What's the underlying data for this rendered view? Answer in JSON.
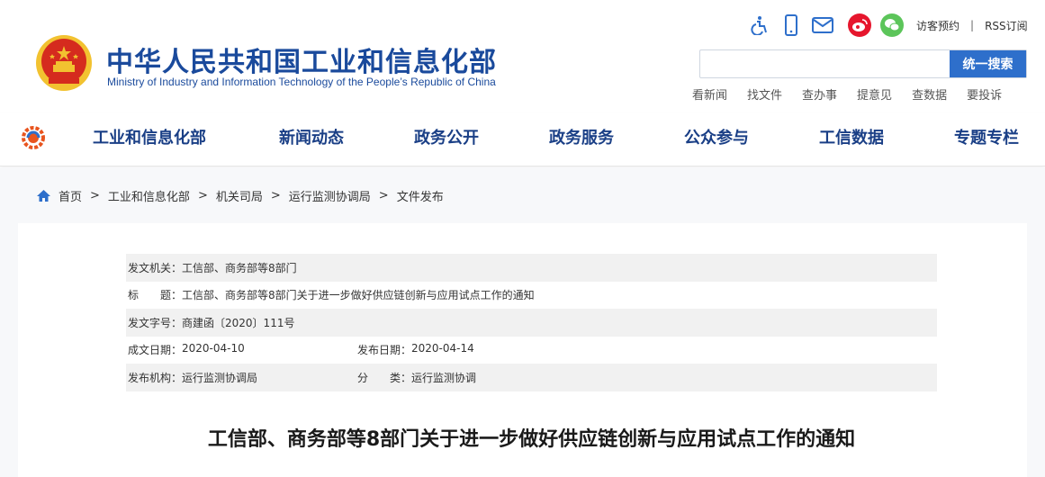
{
  "header": {
    "title_cn": "中华人民共和国工业和信息化部",
    "title_en": "Ministry of Industry and Information Technology of the People’s Republic of China",
    "utility_icons": [
      "accessibility-icon",
      "mobile-icon",
      "mail-icon",
      "weibo-icon",
      "wechat-icon"
    ],
    "visitor_label": "访客预约",
    "separator": "|",
    "rss_label": "RSS订阅",
    "search": {
      "placeholder": "",
      "button_label": "统一搜索"
    },
    "quick_links": [
      "看新闻",
      "找文件",
      "查办事",
      "提意见",
      "查数据",
      "要投诉"
    ]
  },
  "nav": {
    "items": [
      "工业和信息化部",
      "新闻动态",
      "政务公开",
      "政务服务",
      "公众参与",
      "工信数据",
      "专题专栏"
    ]
  },
  "breadcrumb": {
    "items": [
      "首页",
      "工业和信息化部",
      "机关司局",
      "运行监测协调局",
      "文件发布"
    ],
    "separator": ">"
  },
  "meta": {
    "issuer_label": "发文机关：",
    "issuer": "工信部、商务部等8部门",
    "title_label": "标　　题：",
    "title": "工信部、商务部等8部门关于进一步做好供应链创新与应用试点工作的通知",
    "doc_no_label": "发文字号：",
    "doc_no": "商建函〔2020〕111号",
    "created_label": "成文日期：",
    "created": "2020-04-10",
    "published_label": "发布日期：",
    "published": "2020-04-14",
    "agency_label": "发布机构：",
    "agency": "运行监测协调局",
    "category_label": "分　　类：",
    "category": "运行监测协调"
  },
  "article": {
    "title": "工信部、商务部等8部门关于进一步做好供应链创新与应用试点工作的通知"
  },
  "colors": {
    "brand_blue": "#1a4a9c",
    "nav_blue": "#1a3f86",
    "search_button": "#2e6fcb",
    "emblem_red": "#d52b1e",
    "emblem_gold": "#f2c230",
    "weibo_red": "#e6162d",
    "wechat_green": "#5cc55a"
  }
}
